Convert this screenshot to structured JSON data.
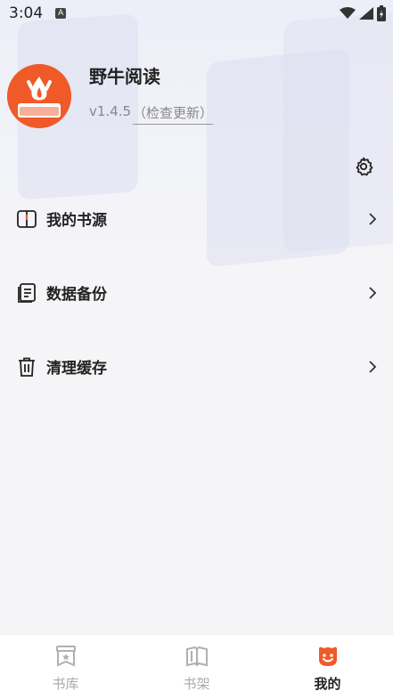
{
  "status_bar": {
    "time": "3:04",
    "notification_icon": "a-icon",
    "wifi": "wifi-icon",
    "signal": "signal-icon",
    "battery": "battery-charging-icon"
  },
  "profile": {
    "app_name": "野牛阅读",
    "version": "v1.4.5",
    "check_update": "（检查更新）"
  },
  "settings": {
    "icon": "gear-icon"
  },
  "menu": {
    "items": [
      {
        "label": "我的书源",
        "icon": "book-icon"
      },
      {
        "label": "数据备份",
        "icon": "backup-icon"
      },
      {
        "label": "清理缓存",
        "icon": "trash-icon"
      }
    ]
  },
  "bottom_nav": {
    "items": [
      {
        "label": "书库",
        "icon": "library-icon",
        "active": false
      },
      {
        "label": "书架",
        "icon": "bookshelf-icon",
        "active": false
      },
      {
        "label": "我的",
        "icon": "mine-icon",
        "active": true
      }
    ]
  },
  "colors": {
    "accent": "#f05a28",
    "background": "#f5f5f7",
    "text": "#222222",
    "muted": "#888888"
  }
}
